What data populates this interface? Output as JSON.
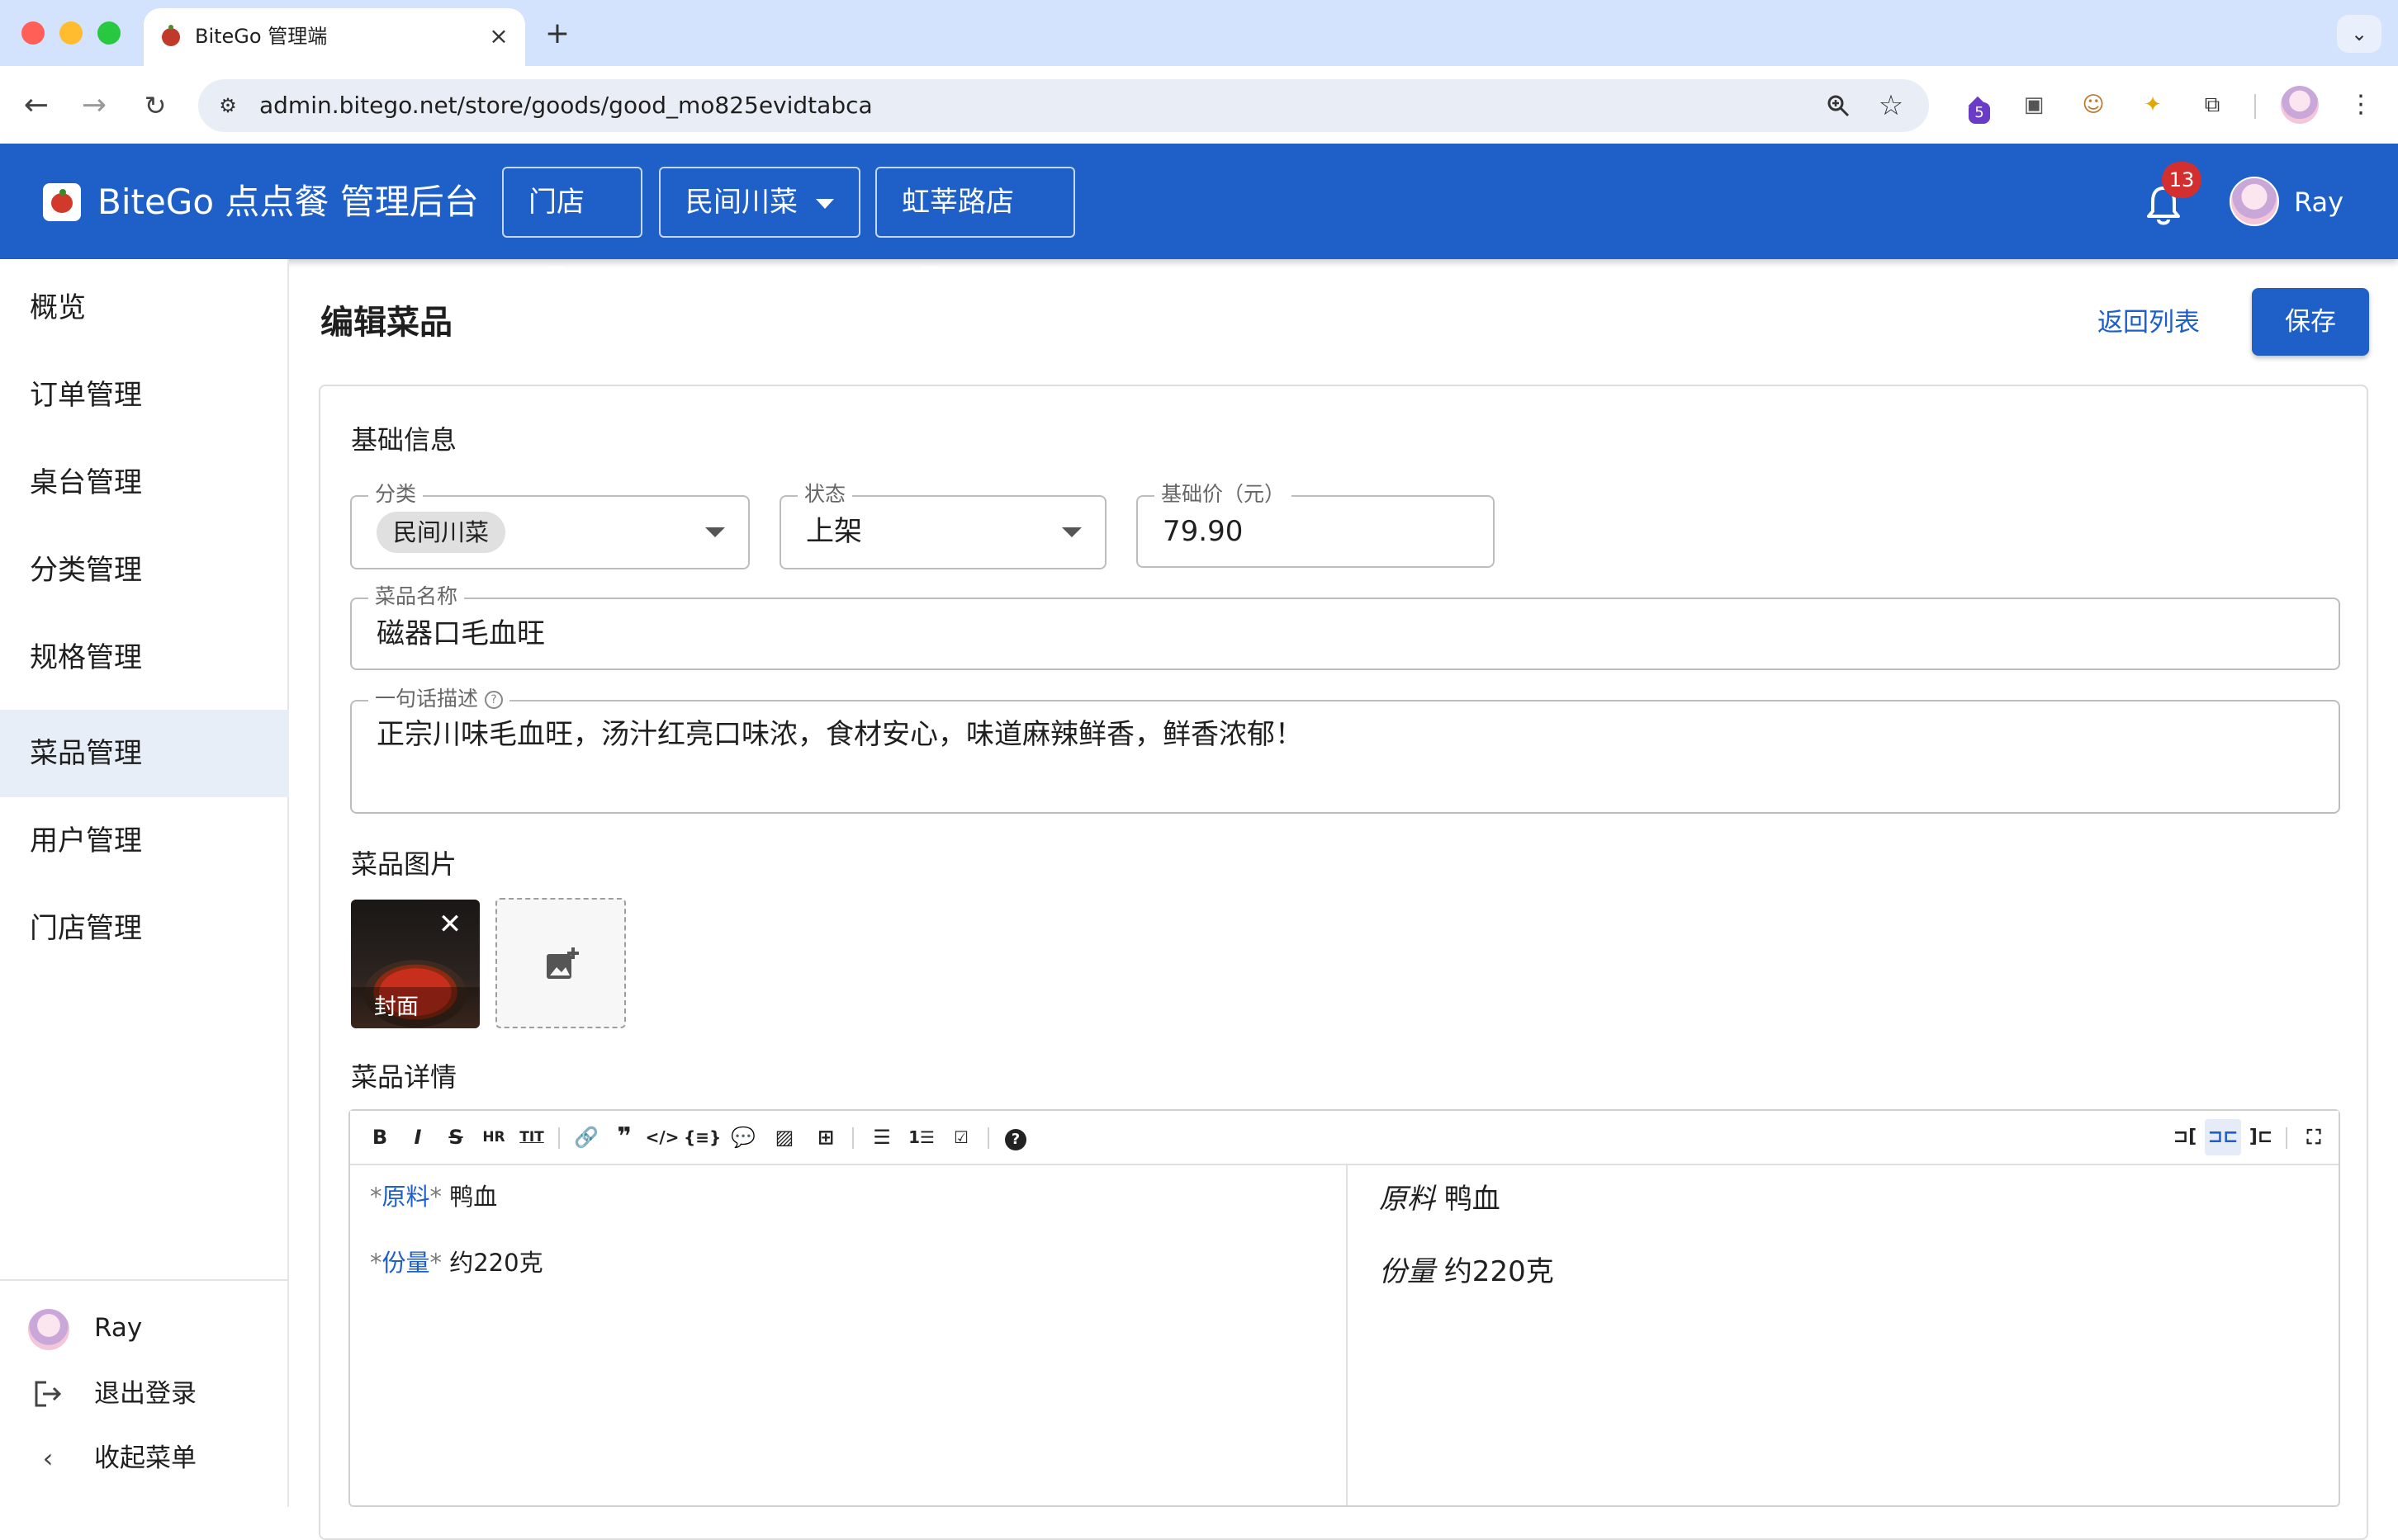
{
  "browser": {
    "tab_title": "BiteGo 管理端",
    "url": "admin.bitego.net/store/goods/good_mo825evidtabca",
    "extension_badge": "5"
  },
  "header": {
    "title": "BiteGo 点点餐 管理后台",
    "selectors": [
      "门店",
      "民间川菜",
      "虹莘路店"
    ],
    "notification_count": "13",
    "user_name": "Ray"
  },
  "sidebar": {
    "items": [
      "概览",
      "订单管理",
      "桌台管理",
      "分类管理",
      "规格管理",
      "菜品管理",
      "用户管理",
      "门店管理"
    ],
    "active_item": "菜品管理",
    "user_name": "Ray",
    "logout_label": "退出登录",
    "collapse_label": "收起菜单"
  },
  "page": {
    "title": "编辑菜品",
    "back_label": "返回列表",
    "save_label": "保存"
  },
  "form": {
    "section_basic": "基础信息",
    "category_label": "分类",
    "category_value": "民间川菜",
    "status_label": "状态",
    "status_value": "上架",
    "price_label": "基础价（元）",
    "price_value": "79.90",
    "name_label": "菜品名称",
    "name_value": "磁器口毛血旺",
    "desc_label": "一句话描述",
    "desc_value": "正宗川味毛血旺，汤汁红亮口味浓，食材安心，味道麻辣鲜香，鲜香浓郁！",
    "images_title": "菜品图片",
    "cover_caption": "封面",
    "detail_title": "菜品详情"
  },
  "editor": {
    "line1_key": "原料",
    "line1_value": "鸭血",
    "line2_key": "份量",
    "line2_value": "约220克"
  }
}
